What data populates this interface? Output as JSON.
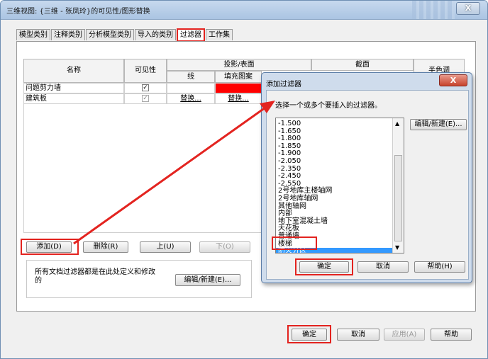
{
  "window": {
    "title": "三维视图: {三维 - 张凤玲}的可见性/图形替换",
    "close": "X"
  },
  "tabs": [
    {
      "label": "模型类别"
    },
    {
      "label": "注释类别"
    },
    {
      "label": "分析模型类别"
    },
    {
      "label": "导入的类别"
    },
    {
      "label": "过滤器"
    },
    {
      "label": "工作集"
    }
  ],
  "table": {
    "col_name": "名称",
    "col_visibility": "可见性",
    "group_projection": "投影/表面",
    "col_line": "线",
    "col_fill": "填充图案",
    "group_section": "截面",
    "col_halftone": "半色调",
    "rows": [
      {
        "name": "问题剪力墙",
        "visible": "✓",
        "line": "",
        "fill": ""
      },
      {
        "name": "建筑板",
        "visible": "✓",
        "line": "替换...",
        "fill": "替换..."
      }
    ],
    "fill_color": "#ff0000"
  },
  "buttons": {
    "add": "添加(D)",
    "delete": "删除(R)",
    "up": "上(U)",
    "down": "下(O)",
    "edit_new": "编辑/新建(E)...",
    "ok": "确定",
    "cancel": "取消",
    "apply": "应用(A)",
    "help": "帮助"
  },
  "info_text": "所有文档过滤器都是在此处定义和修改的",
  "dialog": {
    "title": "添加过滤器",
    "close": "X",
    "prompt": "选择一个或多个要插入的过滤器。",
    "edit_new": "编辑/新建(E)...",
    "ok": "确定",
    "cancel": "取消",
    "help": "帮助(H)",
    "items": [
      "-1.500",
      "-1.650",
      "-1.800",
      "-1.850",
      "-1.900",
      "-2.050",
      "-2.350",
      "-2.450",
      "-2.550",
      "2号地库主楼轴网",
      "2号地库轴网",
      "其他轴网",
      "内部",
      "地下室混凝土墙",
      "天花板",
      "普通墙",
      "楼梯",
      "防火分区"
    ],
    "selected": "防火分区"
  },
  "colors": {
    "accent_red": "#e3231f",
    "selection_blue": "#3399ff"
  }
}
